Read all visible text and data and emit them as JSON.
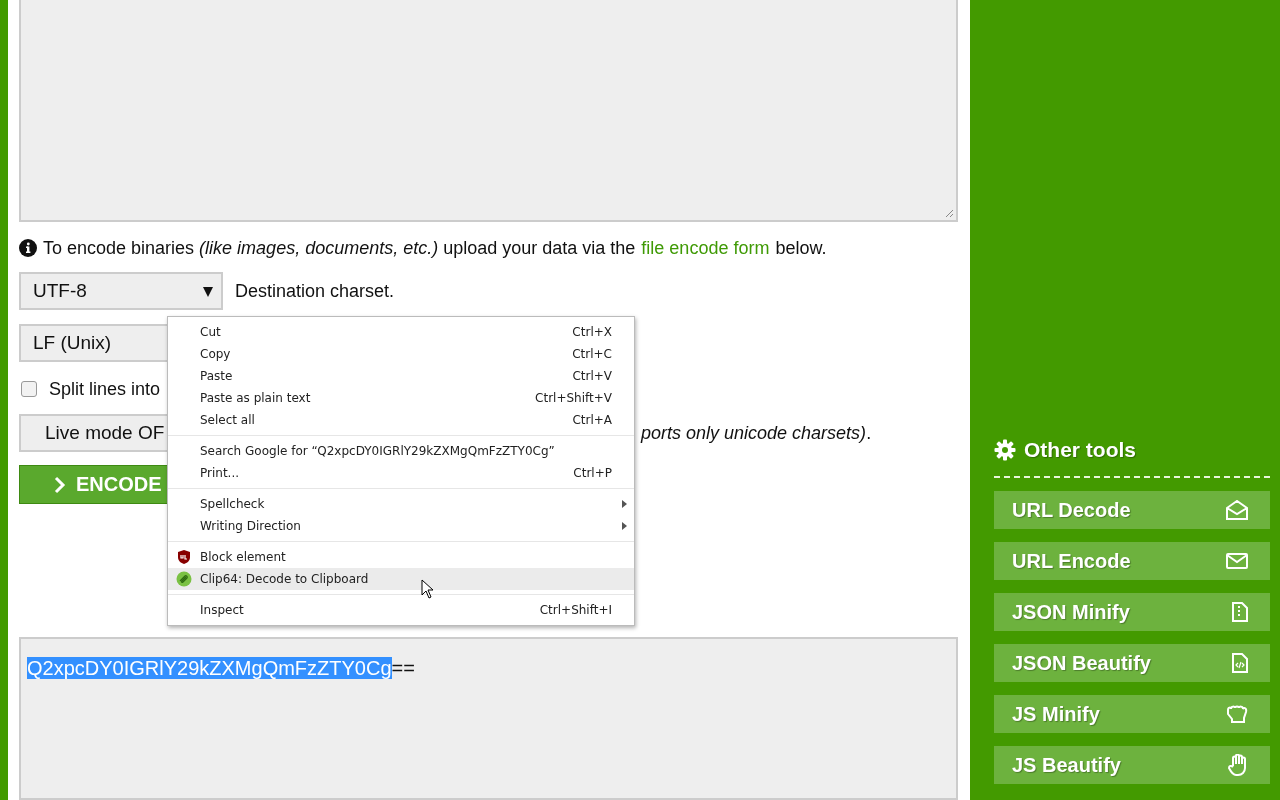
{
  "info": {
    "text": "To encode binaries *(like images, documents, etc.)* upload your data via the",
    "link": "file encode form",
    "after": "below."
  },
  "charset": {
    "value": "UTF-8",
    "label": "Destination charset."
  },
  "newline": {
    "value": "LF (Unix)"
  },
  "split": {
    "label": "Split lines into",
    "checked": false
  },
  "live": {
    "label": "Live mode OF",
    "note": "*ports only unicode charsets)*."
  },
  "encode": {
    "label": "ENCODE"
  },
  "output": {
    "selected_text": "Q2xpcDY0IGRlY29kZXMgQmFzZTY0Cg",
    "rest": "=="
  },
  "context_menu": [
    {
      "kind": "action",
      "label": "Cut",
      "shortcut": "Ctrl+X",
      "selected": false
    },
    {
      "kind": "action",
      "label": "Copy",
      "shortcut": "Ctrl+C",
      "selected": false
    },
    {
      "kind": "action",
      "label": "Paste",
      "shortcut": "Ctrl+V",
      "selected": false
    },
    {
      "kind": "action",
      "label": "Paste as plain text",
      "shortcut": "Ctrl+Shift+V",
      "selected": false
    },
    {
      "kind": "action",
      "label": "Select all",
      "shortcut": "Ctrl+A",
      "selected": false
    },
    {
      "kind": "separator"
    },
    {
      "kind": "action",
      "label": "Search Google for “Q2xpcDY0IGRlY29kZXMgQmFzZTY0Cg”",
      "selected": false
    },
    {
      "kind": "action",
      "label": "Print...",
      "shortcut": "Ctrl+P",
      "selected": false
    },
    {
      "kind": "separator"
    },
    {
      "kind": "submenu",
      "label": "Spellcheck",
      "selected": false
    },
    {
      "kind": "submenu",
      "label": "Writing Direction",
      "selected": false
    },
    {
      "kind": "separator"
    },
    {
      "kind": "shield",
      "label": "Block element",
      "selected": false
    },
    {
      "kind": "clip",
      "label": "Clip64: Decode to Clipboard",
      "selected": true
    },
    {
      "kind": "separator"
    },
    {
      "kind": "action",
      "label": "Inspect",
      "shortcut": "Ctrl+Shift+I",
      "selected": false
    }
  ],
  "sidebar": {
    "title": "Other tools",
    "items": [
      "URL Decode",
      "URL Encode",
      "JSON Minify",
      "JSON Beautify",
      "JS Minify",
      "JS Beautify"
    ]
  }
}
